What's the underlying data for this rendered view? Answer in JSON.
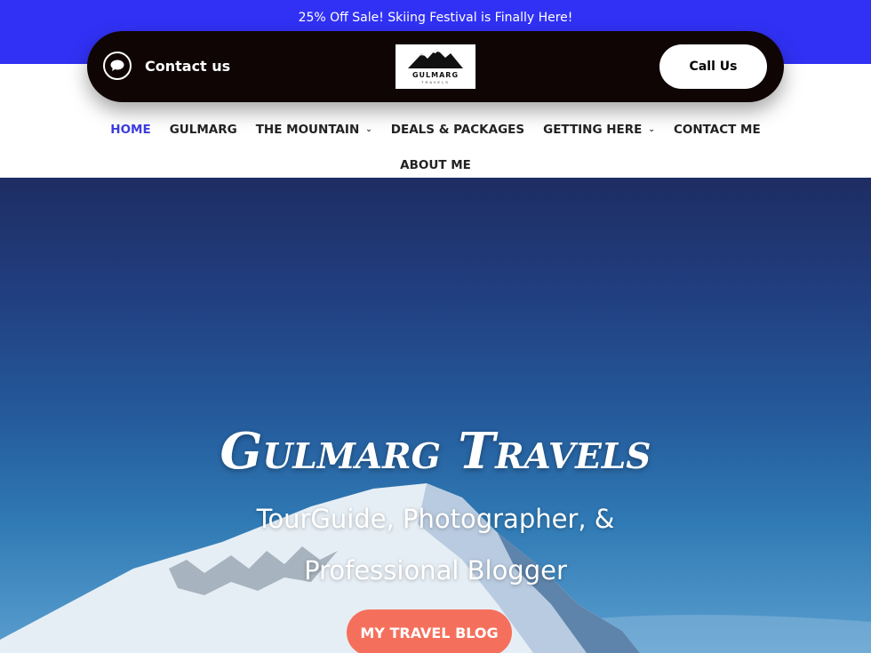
{
  "promo": {
    "text": "25% Off Sale! Skiing Festival  is Finally Here!"
  },
  "header": {
    "contact_label": "Contact us",
    "logo_text": "GULMARG",
    "logo_subtext": "TRAVELS",
    "call_label": "Call Us"
  },
  "nav": {
    "items": [
      {
        "label": "HOME",
        "active": true,
        "dropdown": false
      },
      {
        "label": "GULMARG",
        "dropdown": false
      },
      {
        "label": "THE MOUNTAIN",
        "dropdown": true
      },
      {
        "label": "DEALS & PACKAGES",
        "dropdown": false
      },
      {
        "label": "GETTING HERE",
        "dropdown": true
      },
      {
        "label": "CONTACT ME",
        "dropdown": false
      },
      {
        "label": "ABOUT ME",
        "dropdown": false
      }
    ],
    "dropdown_glyph": "⌄"
  },
  "hero": {
    "title": "Gulmarg Travels",
    "subtitle": "TourGuide, Photographer, & Professional Blogger",
    "button_label": "MY TRAVEL BLOG"
  },
  "colors": {
    "promo_bg": "#3131f5",
    "header_bg": "#0f0505",
    "nav_active": "#3b3be0",
    "button_bg": "#f5705c"
  }
}
